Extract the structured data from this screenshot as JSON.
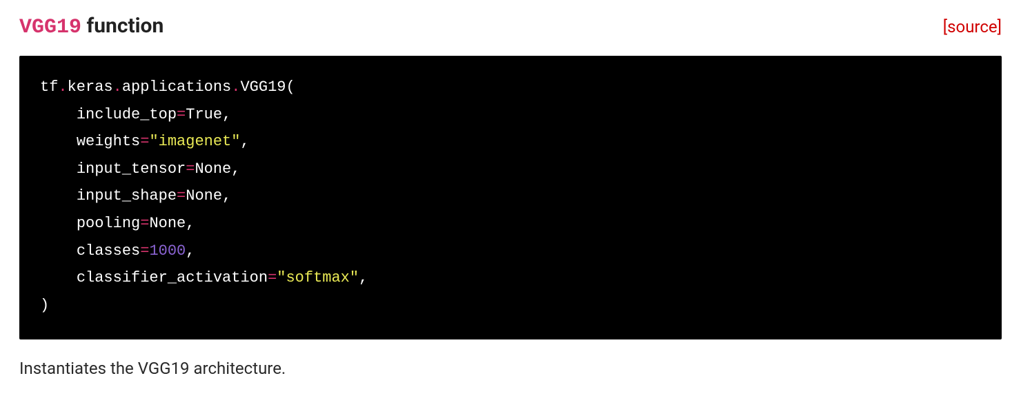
{
  "heading": {
    "function_name": "VGG19",
    "suffix": " function"
  },
  "source_link": "[source]",
  "code": {
    "module_path": [
      "tf",
      "keras",
      "applications",
      "VGG19"
    ],
    "params": [
      {
        "name": "include_top",
        "value": "True",
        "type": "kw"
      },
      {
        "name": "weights",
        "value": "\"imagenet\"",
        "type": "str"
      },
      {
        "name": "input_tensor",
        "value": "None",
        "type": "kw"
      },
      {
        "name": "input_shape",
        "value": "None",
        "type": "kw"
      },
      {
        "name": "pooling",
        "value": "None",
        "type": "kw"
      },
      {
        "name": "classes",
        "value": "1000",
        "type": "num"
      },
      {
        "name": "classifier_activation",
        "value": "\"softmax\"",
        "type": "str"
      }
    ]
  },
  "description": "Instantiates the VGG19 architecture."
}
